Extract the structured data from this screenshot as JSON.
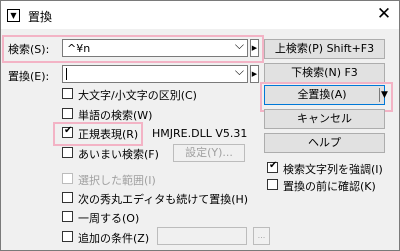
{
  "window": {
    "title": "置換",
    "close_glyph": "✕",
    "sys_menu_glyph": "▼"
  },
  "search": {
    "label": "検索(S):",
    "value": "^¥n",
    "dropdown_glyph": "⌵",
    "side_glyph": "▶"
  },
  "replace": {
    "label": "置換(E):",
    "value": "",
    "dropdown_glyph": "⌵",
    "side_glyph": "▶"
  },
  "options": {
    "case_sensitive": {
      "label": "大文字/小文字の区別(C)",
      "checked": false
    },
    "word_search": {
      "label": "単語の検索(W)",
      "checked": false
    },
    "regex": {
      "label": "正規表現(R)",
      "checked": true
    },
    "regex_engine": "HMJRE.DLL V5.31",
    "fuzzy": {
      "label": "あいまい検索(F)",
      "checked": false
    },
    "settings_button": "設定(Y)...",
    "selection_only": {
      "label": "選択した範囲(I)",
      "checked": false
    },
    "continue_hidemaru": {
      "label": "次の秀丸エディタも続けて置換(H)",
      "checked": false
    },
    "once_around": {
      "label": "一周する(O)",
      "checked": false
    },
    "extra_condition": {
      "label": "追加の条件(Z)",
      "checked": false
    },
    "extra_btn_glyph": "..."
  },
  "buttons": {
    "search_up": "上検索(P) Shift+F3",
    "search_down": "下検索(N) F3",
    "replace_all": "全置換(A)",
    "replace_all_menu": "▼",
    "cancel": "キャンセル",
    "help": "ヘルプ"
  },
  "right_options": {
    "highlight": {
      "label": "検索文字列を強調(I)",
      "checked": true
    },
    "confirm": {
      "label": "置換の前に確認(K)",
      "checked": false
    }
  },
  "check_glyph": "✔"
}
